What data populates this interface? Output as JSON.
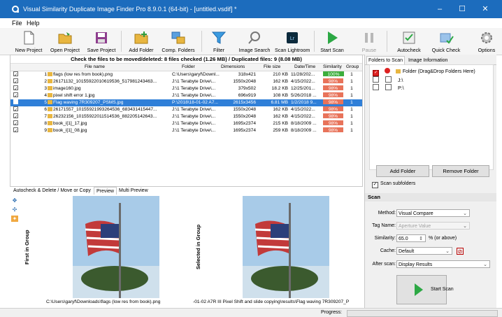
{
  "window": {
    "title": "Visual Similarity Duplicate Image Finder Pro 8.9.0.1 (64-bit) - [untitled.vsdif] *",
    "minimize": "–",
    "maximize": "☐",
    "close": "✕"
  },
  "menu": [
    "File",
    "Help"
  ],
  "toolbar": [
    {
      "label": "New Project",
      "icon": "new-project-icon"
    },
    {
      "label": "Open Project",
      "icon": "open-folder-icon"
    },
    {
      "label": "Save Project",
      "icon": "save-icon"
    },
    {
      "label": "Add Folder",
      "icon": "add-folder-icon"
    },
    {
      "label": "Comp. Folders",
      "icon": "compare-folders-icon"
    },
    {
      "label": "Filter",
      "icon": "filter-icon"
    },
    {
      "label": "Image Search",
      "icon": "search-icon"
    },
    {
      "label": "Scan Lightroom",
      "icon": "lightroom-icon"
    },
    {
      "label": "Start Scan",
      "icon": "play-icon"
    },
    {
      "label": "Pause",
      "icon": "pause-icon"
    },
    {
      "label": "Autocheck",
      "icon": "autocheck-icon"
    },
    {
      "label": "Quick Check",
      "icon": "quick-check-icon"
    },
    {
      "label": "Options",
      "icon": "gear-icon"
    }
  ],
  "results": {
    "summary": "Check the files to be moved/deleted: 8 files checked (1.26 MB) / Duplicated files: 9 (8.08 MB)",
    "columns": [
      "File name",
      "Folder",
      "Dimensions",
      "File size",
      "Date/Time",
      "Similarity",
      "Group"
    ],
    "rows": [
      {
        "idx": "1",
        "name": "flags (low res from book).png",
        "folder": "C:\\Users\\garyf\\Downl...",
        "dim": "318x421",
        "size": "210 KB",
        "date": "11/28/202...",
        "sim": "100%",
        "sim_value": 100,
        "group": "1",
        "checked": true,
        "selected": false
      },
      {
        "idx": "2",
        "name": "26171132_10155922010619536_517981243463...",
        "folder": "J:\\1 Terabyte Drive\\...",
        "dim": "1550x2048",
        "size": "162 KB",
        "date": "4/15/2022...",
        "sim": "98%",
        "sim_value": 98,
        "group": "1",
        "checked": true,
        "selected": false
      },
      {
        "idx": "3",
        "name": "image160.jpg",
        "folder": "J:\\1 Terabyte Drive\\...",
        "dim": "379x502",
        "size": "18.2 KB",
        "date": "12/25/201...",
        "sim": "98%",
        "sim_value": 98,
        "group": "1",
        "checked": true,
        "selected": false
      },
      {
        "idx": "4",
        "name": "pixel shift error 1.jpg",
        "folder": "J:\\1 Terabyte Drive\\...",
        "dim": "696x919",
        "size": "108 KB",
        "date": "5/26/2018 ...",
        "sim": "98%",
        "sim_value": 98,
        "group": "1",
        "checked": true,
        "selected": false
      },
      {
        "idx": "5",
        "name": "Flag waving 7R309207_PSMS.jpg",
        "folder": "P:\\2018\\18-01-02 A7...",
        "dim": "2615x3456",
        "size": "6.81 MB",
        "date": "1/2/2018 9...",
        "sim": "98%",
        "sim_value": 98,
        "group": "1",
        "checked": false,
        "selected": true
      },
      {
        "idx": "6",
        "name": "26171557_10155921993264536_683431415447...",
        "folder": "J:\\1 Terabyte Drive\\...",
        "dim": "1550x2048",
        "size": "162 KB",
        "date": "4/15/2022...",
        "sim": "98%",
        "sim_value": 98,
        "group": "1",
        "checked": true,
        "selected": false
      },
      {
        "idx": "7",
        "name": "26232156_10155922011514536_882205142643...",
        "folder": "J:\\1 Terabyte Drive\\...",
        "dim": "1550x2048",
        "size": "162 KB",
        "date": "4/15/2022...",
        "sim": "98%",
        "sim_value": 98,
        "group": "1",
        "checked": true,
        "selected": false
      },
      {
        "idx": "8",
        "name": "book_i[1]_17.jpg",
        "folder": "J:\\1 Terabyte Drive\\...",
        "dim": "1695x2374",
        "size": "215 KB",
        "date": "8/18/2009 ...",
        "sim": "98%",
        "sim_value": 98,
        "group": "1",
        "checked": true,
        "selected": false
      },
      {
        "idx": "9",
        "name": "book_i[1]_08.jpg",
        "folder": "J:\\1 Terabyte Drive\\...",
        "dim": "1695x2374",
        "size": "259 KB",
        "date": "8/18/2009 ...",
        "sim": "98%",
        "sim_value": 98,
        "group": "1",
        "checked": true,
        "selected": false
      }
    ]
  },
  "bottom_tabs": [
    "Autocheck & Delete / Move or Copy",
    "Preview",
    "Multi Preview"
  ],
  "preview": {
    "first_label": "First in Group",
    "selected_label": "Selected in Group",
    "first_caption": "C:\\Users\\garyf\\Downloads\\flags (low res from book).png",
    "selected_caption": "-01-02 A7R III Pixel Shift and slide copying\\results\\Flag waving 7R309207_P"
  },
  "right_tabs": [
    "Folders to Scan",
    "Image Information"
  ],
  "folders": [
    {
      "label": "Folder (Drag&Drop Folders Here)"
    },
    {
      "label": "J:\\"
    },
    {
      "label": "P:\\"
    }
  ],
  "folder_buttons": {
    "add": "Add Folder",
    "remove": "Remove Folder"
  },
  "scan_subfolders": "Scan subfolders",
  "scan": {
    "header": "Scan",
    "method_label": "Method:",
    "method_value": "Visual Compare",
    "tag_label": "Tag Name:",
    "tag_value": "Aperture Value",
    "similarity_label": "Similarity:",
    "similarity_value": "65.0",
    "similarity_unit": "% (or above)",
    "cache_label": "Cache:",
    "cache_value": "Default",
    "after_label": "After scan:",
    "after_value": "Display Results",
    "start_label": "Start Scan"
  },
  "status": {
    "progress_label": "Progress:"
  },
  "colors": {
    "titlebar": "#1c6cbd",
    "selection": "#2f7fd8",
    "similarity_high": "#3cae3c",
    "similarity": "#e8735a"
  }
}
